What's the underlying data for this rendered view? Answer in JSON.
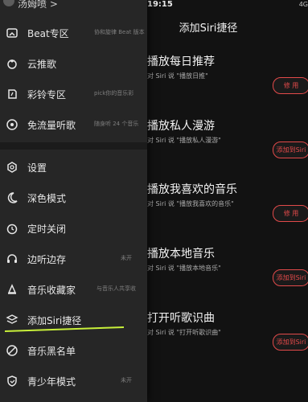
{
  "background_page": {
    "status": {
      "time": "19:15",
      "signal": "4G"
    },
    "title": "添加Siri捷径",
    "shortcuts": [
      {
        "title": "播放每日推荐",
        "hint": "对 Siri 说 \"播放日推\"",
        "button": "修 用"
      },
      {
        "title": "播放私人漫游",
        "hint": "对 Siri 说 \"播放私人漫游\"",
        "button": "添加到Siri"
      },
      {
        "title": "播放我喜欢的音乐",
        "hint": "对 Siri 说 \"播放我喜欢的音乐\"",
        "button": "修 用"
      },
      {
        "title": "播放本地音乐",
        "hint": "对 Siri 说 \"播放本地音乐\"",
        "button": "添加到Siri"
      },
      {
        "title": "打开听歌识曲",
        "hint": "对 Siri 说 \"打开听歌识曲\"",
        "button": "添加到Siri"
      }
    ]
  },
  "drawer": {
    "user_name": "汤姆喷 >",
    "section1": [
      {
        "label": "Beat专区",
        "icon": "beat-icon",
        "sub": "协和旋律 Beat 版本"
      },
      {
        "label": "云推歌",
        "icon": "cloud-push-icon",
        "sub": ""
      },
      {
        "label": "彩铃专区",
        "icon": "ringtone-icon",
        "sub": "pick你的音乐彩"
      },
      {
        "label": "免流量听歌",
        "icon": "free-data-icon",
        "sub": "随身听 24 个音乐"
      }
    ],
    "section2": [
      {
        "label": "设置",
        "icon": "settings-icon",
        "sub": ""
      },
      {
        "label": "深色模式",
        "icon": "dark-mode-icon",
        "sub": ""
      },
      {
        "label": "定时关闭",
        "icon": "timer-icon",
        "sub": ""
      },
      {
        "label": "边听边存",
        "icon": "headphones-icon",
        "sub": "未开"
      },
      {
        "label": "音乐收藏家",
        "icon": "collector-icon",
        "sub": "与音乐人共享收"
      },
      {
        "label": "添加Siri捷径",
        "icon": "layers-icon",
        "sub": ""
      },
      {
        "label": "音乐黑名单",
        "icon": "blocklist-icon",
        "sub": ""
      },
      {
        "label": "青少年模式",
        "icon": "teen-mode-icon",
        "sub": "未开"
      }
    ]
  },
  "colors": {
    "accent": "#e24a4a",
    "underline": "#c8f03a"
  }
}
